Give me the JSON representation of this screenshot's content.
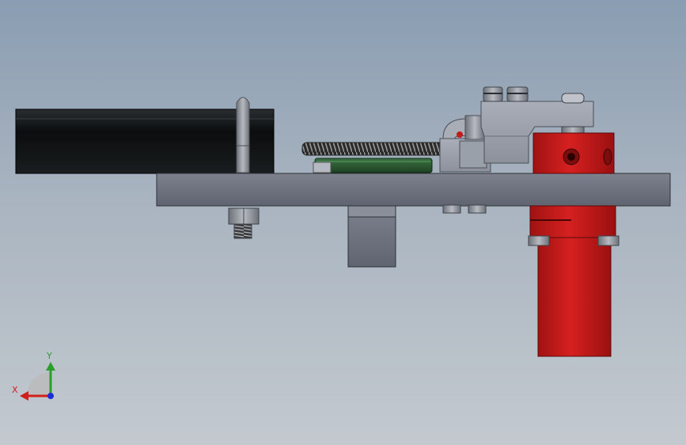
{
  "viewport": {
    "background_top": "#8a9db2",
    "background_bottom": "#c3c9cf"
  },
  "model": {
    "colors": {
      "base_plate": "#6e7380",
      "black_part": "#111416",
      "red_part": "#c31a1a",
      "green_part": "#2c5a32",
      "hardware_gray": "#8e929a",
      "bracket_gray": "#9ea3ad"
    }
  },
  "triad": {
    "x_label": "X",
    "y_label": "Y",
    "x_color": "#d0201a",
    "y_color": "#2aa02a",
    "z_color": "#1f2ad8"
  }
}
